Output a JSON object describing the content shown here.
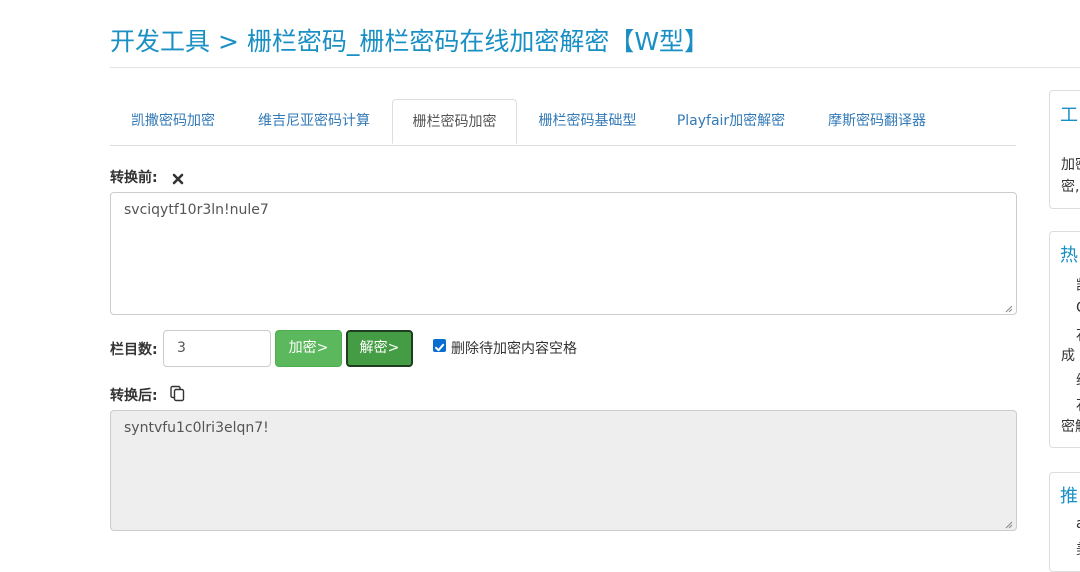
{
  "page_title": "开发工具 > 栅栏密码_栅栏密码在线加密解密【W型】",
  "tabs": [
    {
      "label": "凯撒密码加密"
    },
    {
      "label": "维吉尼亚密码计算"
    },
    {
      "label": "栅栏密码加密"
    },
    {
      "label": "栅栏密码基础型"
    },
    {
      "label": "Playfair加密解密"
    },
    {
      "label": "摩斯密码翻译器"
    }
  ],
  "active_tab": "栅栏密码加密",
  "before": {
    "label": "转换前:",
    "icon": "close-icon",
    "value": "svciqytf10r3ln!nule7"
  },
  "rails": {
    "label": "栏目数:",
    "value": "3"
  },
  "buttons": {
    "encrypt": "加密>",
    "decrypt": "解密>"
  },
  "option": {
    "label": "删除待加密内容空格",
    "checked": true
  },
  "after": {
    "label": "转换后:",
    "icon": "copy-icon",
    "value": "syntvfu1c0lri3elqn7!"
  },
  "sidebar": {
    "card1": {
      "title": "工",
      "lines": [
        "加密",
        "密,"
      ]
    },
    "card2": {
      "title": "热",
      "lines": [
        "凯",
        "C",
        "石",
        "成",
        "维",
        "石",
        "密解"
      ]
    },
    "card3": {
      "title": "推",
      "lines": [
        "a",
        "美"
      ]
    }
  },
  "colors": {
    "title": "#1a8fc4",
    "link": "#337ab7",
    "success": "#5cb85c",
    "success_active": "#449d44",
    "readonly_bg": "#eeeeee"
  }
}
